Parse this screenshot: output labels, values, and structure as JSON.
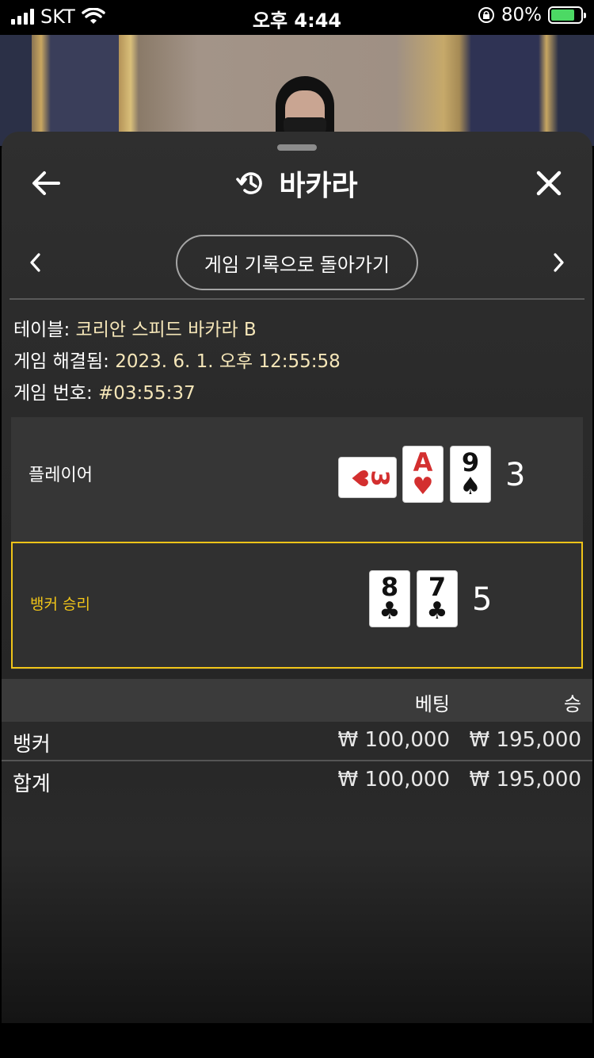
{
  "status_bar": {
    "carrier": "SKT",
    "time": "오후 4:44",
    "battery_percent": "80%",
    "battery_level": 0.8
  },
  "sheet": {
    "title": "바카라",
    "icons": {
      "back": "arrow-left-icon",
      "history": "history-icon",
      "close": "close-icon",
      "prev": "chevron-left-icon",
      "next": "chevron-right-icon"
    },
    "back_to_history_label": "게임 기록으로 돌아가기"
  },
  "info": {
    "table_label": "테이블:",
    "table_value": "코리안 스피드 바카라 B",
    "resolved_label": "게임 해결됨:",
    "resolved_value": "2023. 6. 1. 오후 12:55:58",
    "game_no_label": "게임 번호:",
    "game_no_value": "#03:55:37"
  },
  "result": {
    "player": {
      "label": "플레이어",
      "score": "3",
      "cards": [
        {
          "rank": "3",
          "suit": "♥",
          "color": "red",
          "sideways": true
        },
        {
          "rank": "A",
          "suit": "♥",
          "color": "red",
          "sideways": false
        },
        {
          "rank": "9",
          "suit": "♠",
          "color": "black",
          "sideways": false
        }
      ]
    },
    "banker": {
      "label": "뱅커 승리",
      "score": "5",
      "cards": [
        {
          "rank": "8",
          "suit": "♣",
          "color": "black",
          "sideways": false
        },
        {
          "rank": "7",
          "suit": "♣",
          "color": "black",
          "sideways": false
        }
      ]
    }
  },
  "bets": {
    "col_bet": "베팅",
    "col_win": "승",
    "rows": [
      {
        "name": "뱅커",
        "bet": "₩ 100,000",
        "win": "₩ 195,000"
      },
      {
        "name": "합계",
        "bet": "₩ 100,000",
        "win": "₩ 195,000"
      }
    ]
  },
  "colors": {
    "accent": "#f0c419",
    "battery": "#4cd964",
    "card_red": "#d32f2f"
  }
}
